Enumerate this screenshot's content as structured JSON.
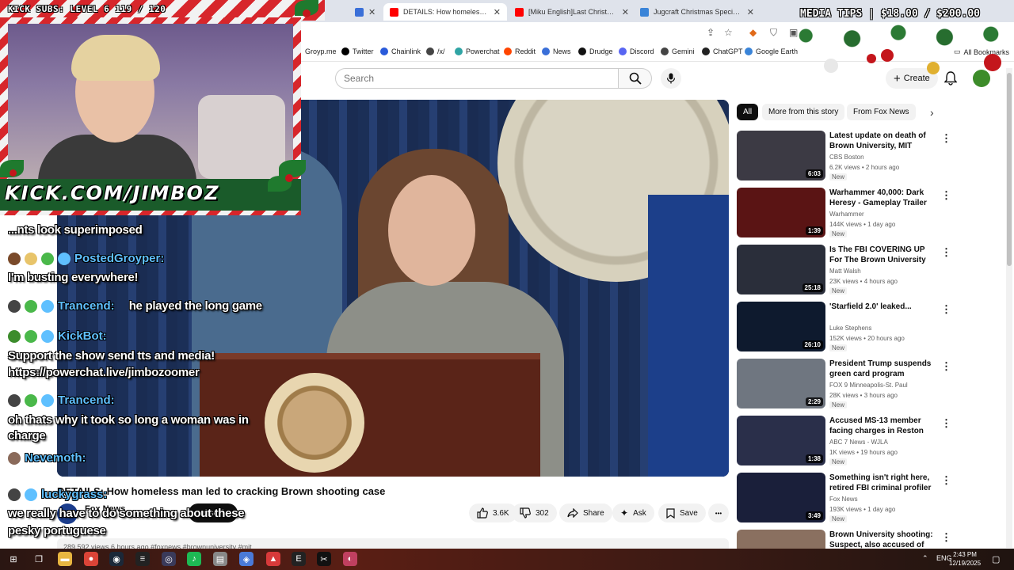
{
  "browser": {
    "tabs": [
      {
        "title": "",
        "icon": "page-icon",
        "color": "#3a6fd8"
      },
      {
        "title": "DETAILS: How homeless man le",
        "icon": "youtube-icon",
        "color": "#ff0000"
      },
      {
        "title": "[Miku English]Last Christmas",
        "icon": "youtube-icon",
        "color": "#ff0000"
      },
      {
        "title": "Jugcraft Christmas Special - Sh",
        "icon": "jugcraft-icon",
        "color": "#3a84d8"
      }
    ],
    "close_glyph": "✕",
    "bookmarks": [
      {
        "label": "Groyp.me",
        "icon": "none"
      },
      {
        "label": "Twitter",
        "icon": "x-icon",
        "color": "#000000"
      },
      {
        "label": "Chainlink",
        "icon": "chainlink-icon",
        "color": "#2a5ada"
      },
      {
        "label": "/x/",
        "icon": "clover-icon",
        "color": "#444444"
      },
      {
        "label": "Powerchat",
        "icon": "powerchat-icon",
        "color": "#2fa4a4"
      },
      {
        "label": "Reddit",
        "icon": "reddit-icon",
        "color": "#ff4500"
      },
      {
        "label": "News",
        "icon": "news-icon",
        "color": "#3a6fd8"
      },
      {
        "label": "Drudge",
        "icon": "drudge-icon",
        "color": "#111111"
      },
      {
        "label": "Discord",
        "icon": "discord-icon",
        "color": "#5865f2"
      },
      {
        "label": "Gemini",
        "icon": "gemini-icon",
        "color": "#444444"
      },
      {
        "label": "ChatGPT",
        "icon": "chatgpt-icon",
        "color": "#222222"
      },
      {
        "label": "Google Earth",
        "icon": "earth-icon",
        "color": "#3a84d8"
      }
    ],
    "all_bookmarks": "All Bookmarks"
  },
  "header": {
    "search_placeholder": "Search",
    "create_label": "Create",
    "create_glyph": "+"
  },
  "video": {
    "title": "DETAILS: How homeless man led to cracking Brown shooting case",
    "channel": "Fox News",
    "subscribe_label": "Subscribe",
    "likes": "3.6K",
    "dislikes": "302",
    "share_label": "Share",
    "ask_label": "Ask",
    "save_label": "Save",
    "more_glyph": "•••",
    "description_meta": "289,592 views  6 hours ago  #foxnews #brownuniversity #mit"
  },
  "chips": [
    {
      "label": "All",
      "active": true
    },
    {
      "label": "More from this story",
      "active": false
    },
    {
      "label": "From Fox News",
      "active": false
    }
  ],
  "chip_next_glyph": "›",
  "recommendations": [
    {
      "title": "Latest update on death of Brown University, MIT profess...",
      "channel": "CBS Boston",
      "meta": "6.2K views • 2 hours ago",
      "badge": "New",
      "duration": "6:03",
      "thumb_color": "#3c3a44"
    },
    {
      "title": "Warhammer 40,000: Dark Heresy - Gameplay Trailer",
      "channel": "Warhammer",
      "meta": "144K views • 1 day ago",
      "badge": "New",
      "duration": "1:39",
      "thumb_color": "#5a1414"
    },
    {
      "title": "Is The FBI COVERING UP For The Brown University Shooter?",
      "channel": "Matt Walsh",
      "meta": "23K views • 4 hours ago",
      "badge": "New",
      "duration": "25:18",
      "thumb_color": "#2a2e3a"
    },
    {
      "title": "'Starfield 2.0' leaked...",
      "channel": "Luke Stephens",
      "meta": "152K views • 20 hours ago",
      "badge": "New",
      "duration": "26:10",
      "thumb_color": "#0e1a2e"
    },
    {
      "title": "President Trump suspends green card program",
      "channel": "FOX 9 Minneapolis-St. Paul",
      "meta": "28K views • 3 hours ago",
      "badge": "New",
      "duration": "2:29",
      "thumb_color": "#6f7680"
    },
    {
      "title": "Accused MS-13 member facing charges in Reston shooting ha...",
      "channel": "ABC 7 News - WJLA",
      "meta": "1K views • 19 hours ago",
      "badge": "New",
      "duration": "1:38",
      "thumb_color": "#2a2f4a"
    },
    {
      "title": "Something isn't right here, retired FBI criminal profiler ...",
      "channel": "Fox News",
      "meta": "193K views • 1 day ago",
      "badge": "New",
      "duration": "3:49",
      "thumb_color": "#1a1f3a"
    },
    {
      "title": "Brown University shooting: Suspect, also accused of killin...",
      "channel": "",
      "meta": "",
      "badge": "",
      "duration": "",
      "thumb_color": "#8a7060"
    }
  ],
  "overlay": {
    "kick_subs": "KICK SUBS: LEVEL 6 119 / 120",
    "kick_url": "KICK.COM/JIMBOZ",
    "media_tips": "MEDIA TIPS | $18.00 / $200.00"
  },
  "chat": [
    {
      "type": "text",
      "text": "...nts look superimposed"
    },
    {
      "type": "user",
      "user": "PostedGroyper:",
      "badges": [
        "#7a4a2a",
        "#e8c46a",
        "#4ab84a",
        "#5fc0ff"
      ]
    },
    {
      "type": "text",
      "text": "I'm busting everywhere!"
    },
    {
      "type": "user",
      "user": "Trancend:",
      "message": "he played the long game",
      "badges": [
        "#444444",
        "#4ab84a",
        "#5fc0ff"
      ]
    },
    {
      "type": "user",
      "user": "KickBot:",
      "badges": [
        "#3c8c2c",
        "#4ab84a",
        "#5fc0ff"
      ]
    },
    {
      "type": "text",
      "text": "Support the show send tts and media!"
    },
    {
      "type": "text",
      "text": "https://powerchat.live/jimbozoomer"
    },
    {
      "type": "user",
      "user": "Trancend:",
      "badges": [
        "#444444",
        "#4ab84a",
        "#5fc0ff"
      ]
    },
    {
      "type": "text",
      "text": "oh thats why it took so long a woman was in"
    },
    {
      "type": "text",
      "text": "charge"
    },
    {
      "type": "user",
      "user": "Nevemoth:",
      "badges": [
        "#8a6a5a"
      ]
    },
    {
      "type": "user",
      "user": "luckygrass:",
      "badges": [
        "#444444",
        "#5fc0ff"
      ]
    },
    {
      "type": "text",
      "text": "we really have to do something about these"
    },
    {
      "type": "text",
      "text": "pesky portuguese"
    }
  ],
  "taskbar": {
    "icons": [
      {
        "name": "windows-start-icon",
        "color": "#ffffff",
        "glyph": "⊞"
      },
      {
        "name": "task-view-icon",
        "color": "#ffffff",
        "glyph": "❐"
      },
      {
        "name": "file-explorer-icon",
        "color": "#e8b640",
        "glyph": "▬"
      },
      {
        "name": "chrome-icon",
        "color": "#db4437",
        "glyph": "●"
      },
      {
        "name": "steam-icon",
        "color": "#1b2838",
        "glyph": "◉"
      },
      {
        "name": "terminal-icon",
        "color": "#222222",
        "glyph": "≡"
      },
      {
        "name": "obs-icon",
        "color": "#3a3a5a",
        "glyph": "◎"
      },
      {
        "name": "spotify-icon",
        "color": "#1db954",
        "glyph": "♪"
      },
      {
        "name": "app-icon",
        "color": "#888888",
        "glyph": "▤"
      },
      {
        "name": "app-icon-2",
        "color": "#4a7ad8",
        "glyph": "◈"
      },
      {
        "name": "app-icon-3",
        "color": "#d83a3a",
        "glyph": "▲"
      },
      {
        "name": "epic-games-icon",
        "color": "#222222",
        "glyph": "E"
      },
      {
        "name": "capcut-icon",
        "color": "#111111",
        "glyph": "✂"
      },
      {
        "name": "app-icon-4",
        "color": "#c04060",
        "glyph": "◐"
      }
    ],
    "language": "ENG",
    "time": "2:43 PM",
    "date": "12/19/2025"
  },
  "colors": {
    "youtube_red": "#ff0000",
    "candy_red": "#d7262b",
    "chat_user": "#5fc0ff"
  }
}
